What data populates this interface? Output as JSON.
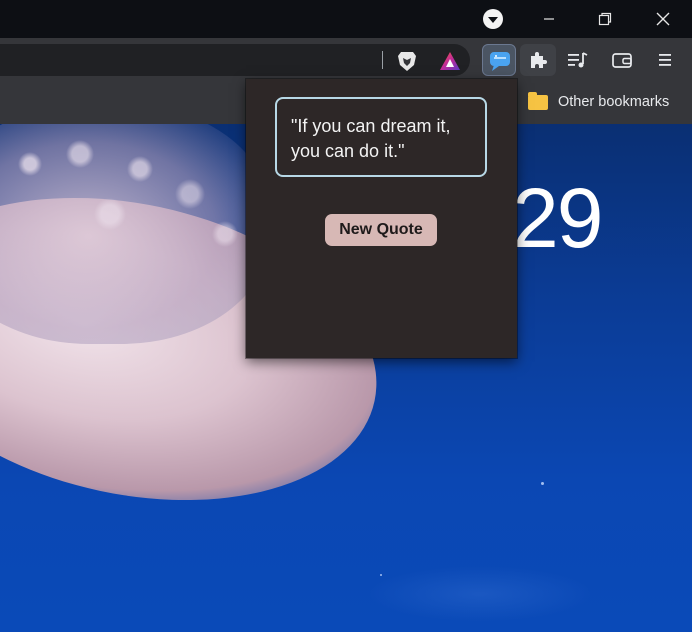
{
  "titlebar": {
    "profile_icon": "profile-dropdown-icon",
    "minimize_icon": "minimize-icon",
    "restore_icon": "restore-icon",
    "close_icon": "close-icon"
  },
  "toolbar": {
    "brave_shields_icon": "brave-lion-icon",
    "brave_rewards_icon": "brave-rewards-triangle-icon",
    "quote_extension_icon": "chat-bubble-icon",
    "extensions_icon": "puzzle-icon",
    "media_icon": "playlist-icon",
    "wallet_icon": "wallet-icon",
    "menu_icon": "hamburger-menu-icon"
  },
  "bookmarks": {
    "other_label": "Other bookmarks",
    "folder_icon": "folder-icon"
  },
  "newtab": {
    "clock_text": "29"
  },
  "popup": {
    "quote_text": "\"If you can dream it, you can do it.\"",
    "button_label": "New Quote"
  },
  "colors": {
    "popup_bg": "#2d2727",
    "quote_border": "#b7d8e6",
    "button_bg": "#d7b8b5",
    "toolbar_bg": "#35363a",
    "titlebar_bg": "#0d0f14",
    "folder": "#f6c343"
  }
}
